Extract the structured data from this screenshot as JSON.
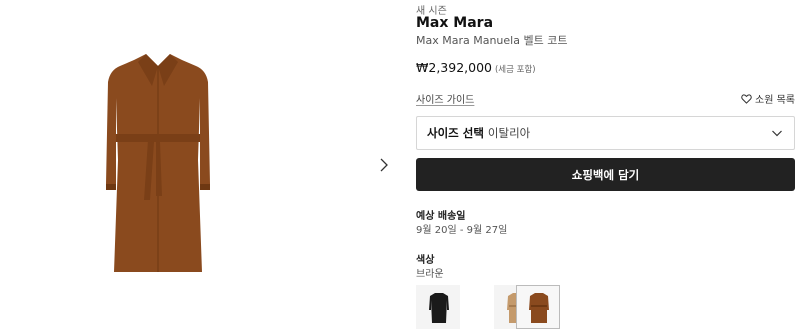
{
  "product": {
    "tag": "새 시즌",
    "brand": "Max Mara",
    "name": "Max Mara Manuela 벨트 코트",
    "price": "₩2,392,000",
    "tax_note": "(세금 포함)"
  },
  "actions": {
    "size_guide": "사이즈 가이드",
    "wishlist": "소원 목록",
    "size_select_label": "사이즈 선택",
    "size_select_value": "이탈리아",
    "add_to_bag": "쇼핑백에 담기"
  },
  "delivery": {
    "title": "예상 배송일",
    "dates": "9월 20일 - 9월 27일"
  },
  "color": {
    "title": "색상",
    "value": "브라운",
    "swatches": [
      {
        "name": "black",
        "color": "#1a1a1a",
        "selected": false
      },
      {
        "name": "camel",
        "color": "#c49a6c",
        "selected": false
      },
      {
        "name": "brown",
        "color": "#8a4a1e",
        "selected": true
      }
    ]
  },
  "icons": [
    "chevron-right-icon",
    "heart-icon",
    "chevron-down-icon"
  ],
  "colors": {
    "button_bg": "#222222",
    "coat_main": "#8a4a1e"
  }
}
